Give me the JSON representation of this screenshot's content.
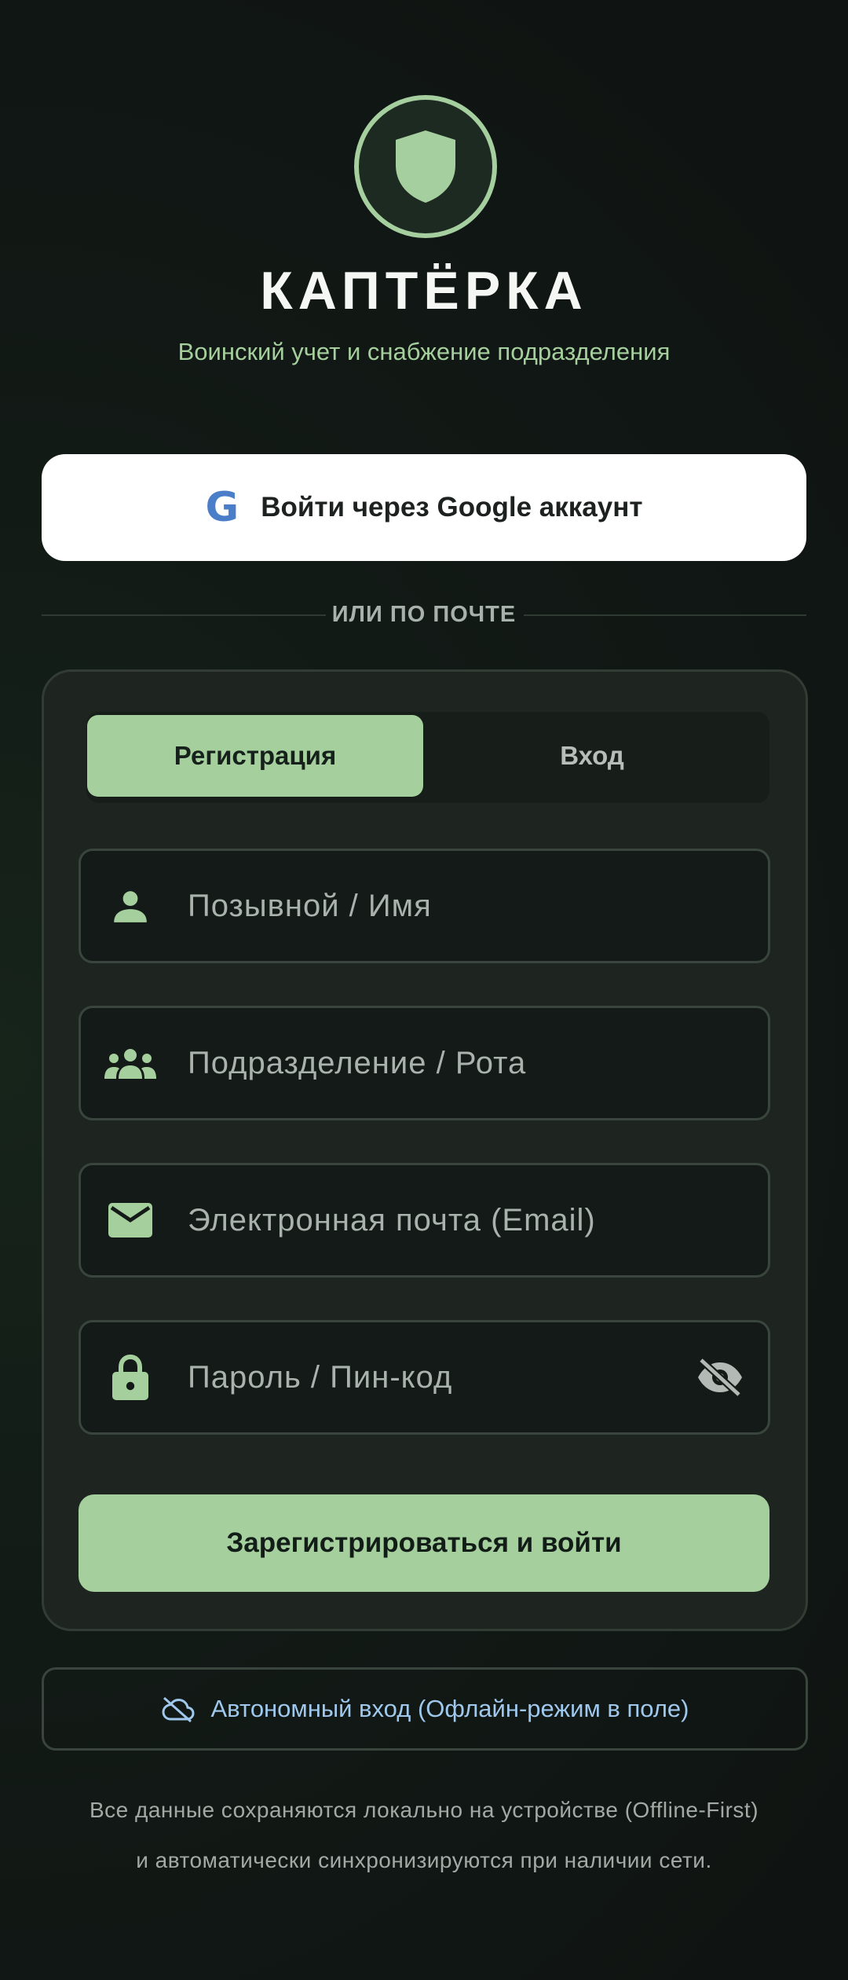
{
  "app": {
    "title": "КАПТЁРКА",
    "subtitle": "Воинский учет и снабжение подразделения"
  },
  "google": {
    "icon_letter": "G",
    "label": "Войти через Google аккаунт"
  },
  "divider": {
    "text": "ИЛИ ПО ПОЧТЕ"
  },
  "tabs": [
    {
      "label": "Регистрация",
      "active": true
    },
    {
      "label": "Вход",
      "active": false
    }
  ],
  "fields": {
    "name": {
      "value": "",
      "placeholder": "Позывной / Имя",
      "icon": "person-icon"
    },
    "unit": {
      "value": "",
      "placeholder": "Подразделение / Рота",
      "icon": "group-icon"
    },
    "email": {
      "value": "",
      "placeholder": "Электронная почта (Email)",
      "icon": "mail-icon"
    },
    "password": {
      "value": "",
      "placeholder": "Пароль / Пин-код",
      "icon": "lock-icon",
      "toggle_icon": "eye-off-icon"
    }
  },
  "submit": {
    "label": "Зарегистрироваться и войти"
  },
  "offline": {
    "icon": "cloud-off-icon",
    "label": "Автономный вход (Офлайн-режим в поле)"
  },
  "footer": {
    "line1": "Все данные сохраняются локально на устройстве (Offline-First)",
    "line2": "и автоматически синхронизируются при наличии сети."
  },
  "colors": {
    "accent": "#a6cf9e",
    "background": "#121a16",
    "card": "#1e2521",
    "link": "#9fc8ec"
  }
}
